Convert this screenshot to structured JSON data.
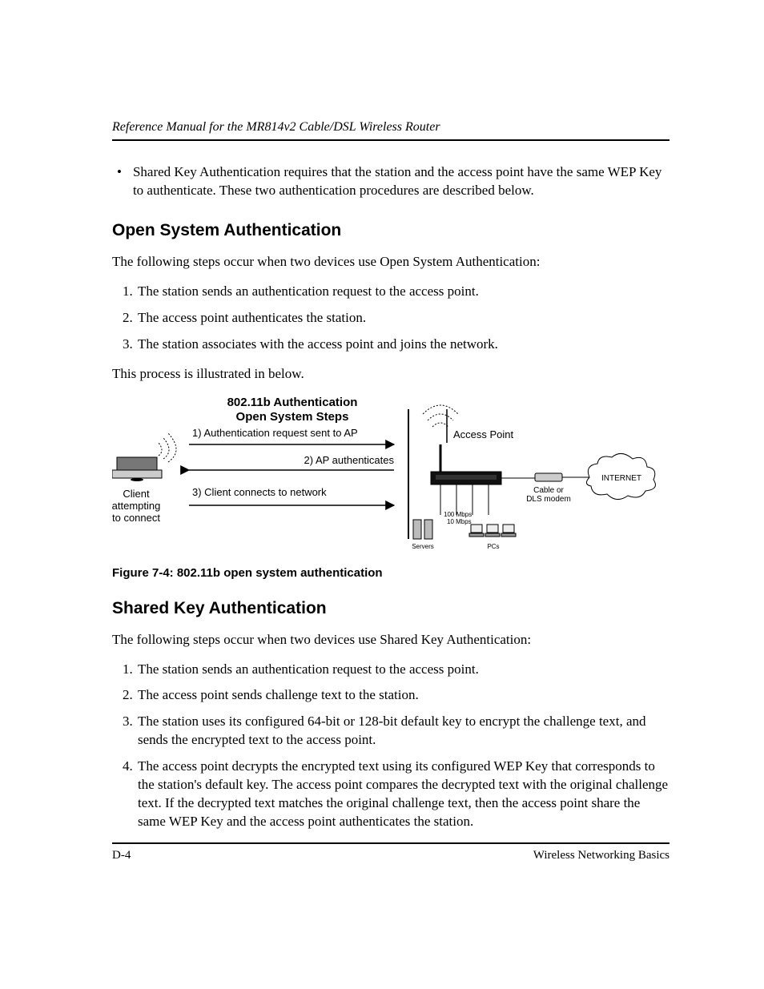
{
  "header": {
    "title": "Reference Manual for the MR814v2 Cable/DSL Wireless Router"
  },
  "intro_bullet": "Shared Key Authentication requires that the station and the access point have the same WEP Key to authenticate. These two authentication procedures are described below.",
  "open_system": {
    "heading": "Open System Authentication",
    "lead": "The following steps occur when two devices use Open System Authentication:",
    "steps": [
      "The station sends an authentication request to the access point.",
      "The access point authenticates the station.",
      "The station associates with the access point and joins the network."
    ],
    "closing": "This process is illustrated in below."
  },
  "figure": {
    "title_l1": "802.11b Authentication",
    "title_l2": "Open System Steps",
    "step1": "1) Authentication request sent to AP",
    "step2": "2) AP authenticates",
    "step3": "3) Client connects to network",
    "client_l1": "Client",
    "client_l2": "attempting",
    "client_l3": "to connect",
    "ap_label": "Access Point",
    "modem_l1": "Cable or",
    "modem_l2": "DLS modem",
    "internet": "INTERNET",
    "servers": "Servers",
    "pcs": "PCs",
    "speed1": "100 Mbps",
    "speed2": "10 Mbps",
    "caption": "Figure 7-4:  802.11b open system authentication"
  },
  "shared_key": {
    "heading": "Shared Key Authentication",
    "lead": "The following steps occur when two devices use Shared Key Authentication:",
    "steps": [
      "The station sends an authentication request to the access point.",
      "The access point sends challenge text to the station.",
      "The station uses its configured 64-bit or 128-bit default key to encrypt the challenge text, and sends the encrypted text to the access point.",
      "The access point decrypts the encrypted text using its configured WEP Key that corresponds to the station's default key. The access point compares the decrypted text with the original challenge text. If the decrypted text matches the original challenge text, then the access point share the same WEP Key and the access point authenticates the station."
    ]
  },
  "footer": {
    "page": "D-4",
    "section": "Wireless Networking Basics"
  }
}
